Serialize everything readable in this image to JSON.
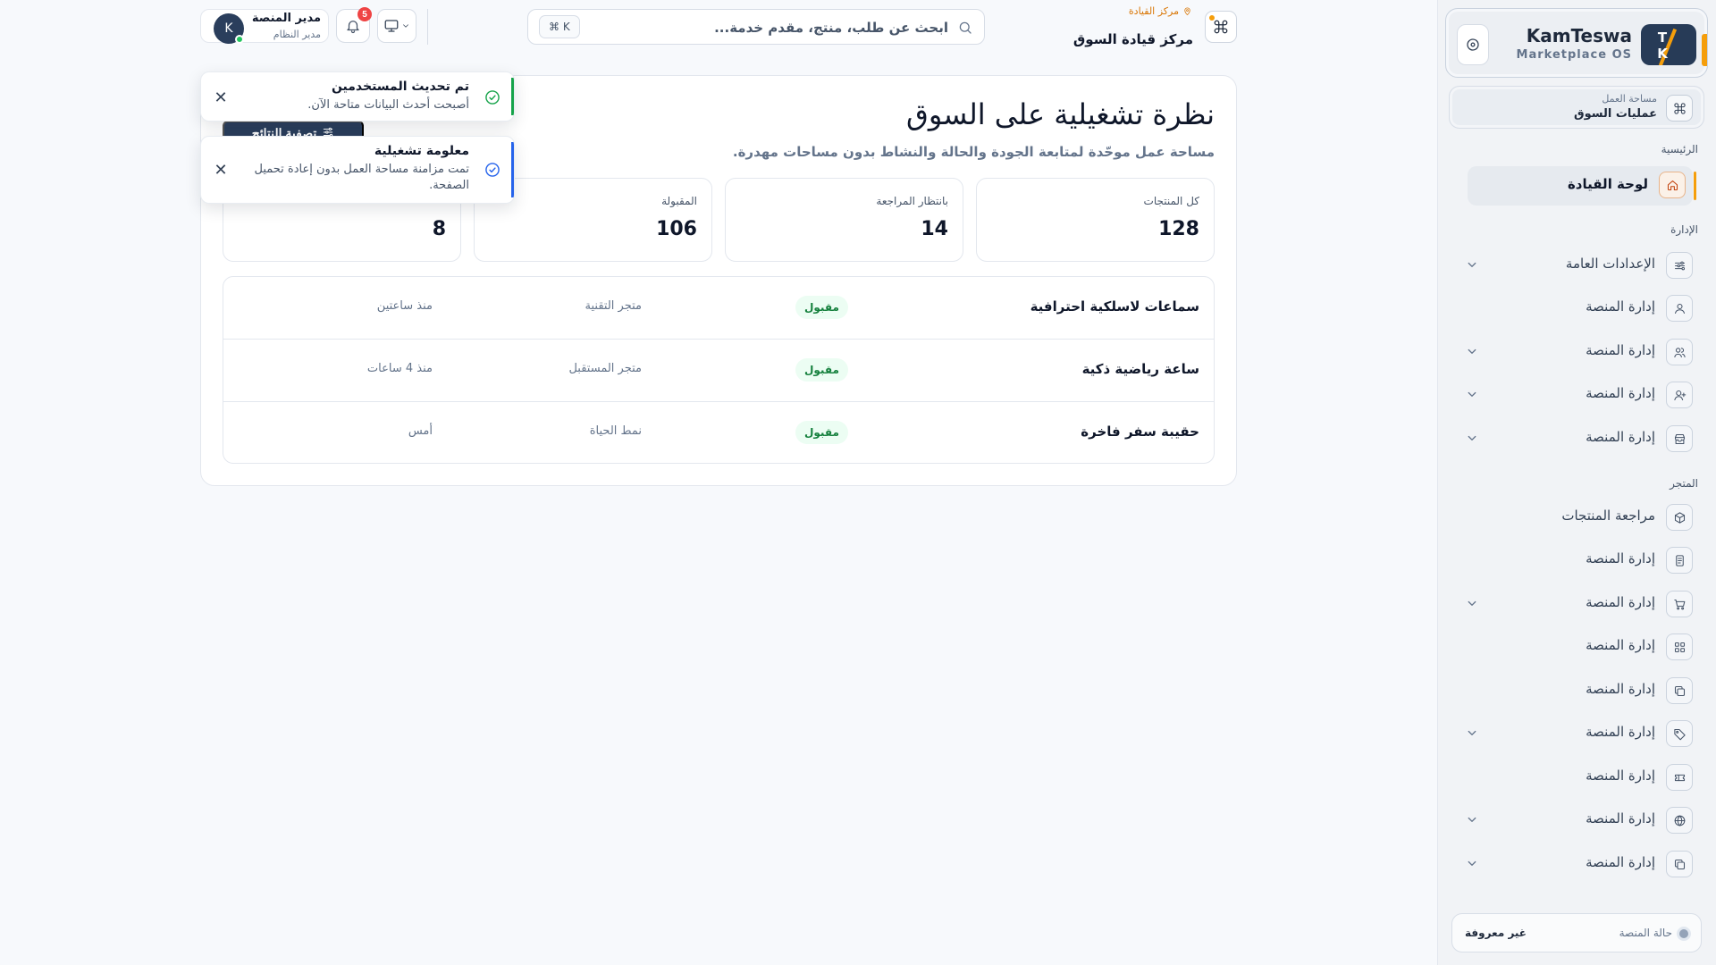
{
  "brand": {
    "name": "KamTeswa",
    "subtitle": "Marketplace OS",
    "logo_letters": "T K"
  },
  "workspace": {
    "label": "مساحة العمل",
    "value": "عمليات السوق"
  },
  "sidebar": {
    "sections": [
      {
        "title": "الرئيسية"
      },
      {
        "title": "الإدارة"
      },
      {
        "title": "المتجر"
      }
    ],
    "items": [
      {
        "label": "لوحة القيادة",
        "icon": "home-icon",
        "active": true,
        "chevron": false
      },
      {
        "label": "الإعدادات العامة",
        "icon": "sliders-icon",
        "chevron": true
      },
      {
        "label": "إدارة المنصة",
        "icon": "user-icon",
        "chevron": false
      },
      {
        "label": "إدارة المنصة",
        "icon": "users-icon",
        "chevron": true
      },
      {
        "label": "إدارة المنصة",
        "icon": "user-plus-icon",
        "chevron": true
      },
      {
        "label": "إدارة المنصة",
        "icon": "store-icon",
        "chevron": true
      },
      {
        "label": "مراجعة المنتجات",
        "icon": "box-icon",
        "chevron": false
      },
      {
        "label": "إدارة المنصة",
        "icon": "document-icon",
        "chevron": false
      },
      {
        "label": "إدارة المنصة",
        "icon": "cart-icon",
        "chevron": true
      },
      {
        "label": "إدارة المنصة",
        "icon": "grid-icon",
        "chevron": false
      },
      {
        "label": "إدارة المنصة",
        "icon": "copy-icon",
        "chevron": false
      },
      {
        "label": "إدارة المنصة",
        "icon": "tag-icon",
        "chevron": true
      },
      {
        "label": "إدارة المنصة",
        "icon": "ticket-icon",
        "chevron": false
      },
      {
        "label": "إدارة المنصة",
        "icon": "globe-icon",
        "chevron": true
      },
      {
        "label": "إدارة المنصة",
        "icon": "copy-icon",
        "chevron": true
      }
    ],
    "status": {
      "label": "حالة المنصة",
      "value": "غير معروفة"
    }
  },
  "topbar": {
    "breadcrumb": "مركز القيادة",
    "page_title": "مركز قيادة السوق",
    "search_placeholder": "ابحث عن طلب، منتج، مقدم خدمة...",
    "shortcut": "⌘  K",
    "notifications_count": "5",
    "user": {
      "name": "مدير المنصة",
      "role": "مدير النظام",
      "initial": "K"
    }
  },
  "main": {
    "title": "نظرة تشغيلية على السوق",
    "subtitle": "مساحة عمل موحّدة لمتابعة الجودة والحالة والنشاط بدون مساحات مهدرة.",
    "filter_label": "تصفية النتائج",
    "stats": [
      {
        "label": "كل المنتجات",
        "value": "128"
      },
      {
        "label": "بانتظار المراجعة",
        "value": "14"
      },
      {
        "label": "المقبولة",
        "value": "106"
      },
      {
        "label": "",
        "value": "8"
      }
    ],
    "rows": [
      {
        "name": "سماعات لاسلكية احترافية",
        "status": "مقبول",
        "store": "متجر التقنية",
        "time": "منذ ساعتين"
      },
      {
        "name": "ساعة رياضية ذكية",
        "status": "مقبول",
        "store": "متجر المستقبل",
        "time": "منذ 4 ساعات"
      },
      {
        "name": "حقيبة سفر فاخرة",
        "status": "مقبول",
        "store": "نمط الحياة",
        "time": "أمس"
      }
    ]
  },
  "toasts": [
    {
      "title": "تم تحديث المستخدمين",
      "message": "أصبحت أحدث البيانات متاحة الآن.",
      "type": "success",
      "color": "#16a34a"
    },
    {
      "title": "معلومة تشغيلية",
      "message": "تمت مزامنة مساحة العمل بدون إعادة تحميل الصفحة.",
      "type": "info",
      "color": "#2563eb"
    }
  ],
  "colors": {
    "accent": "#f59e0b",
    "primary": "#2a3e5c",
    "success": "#16a34a",
    "info": "#2563eb",
    "danger": "#ef4444"
  }
}
